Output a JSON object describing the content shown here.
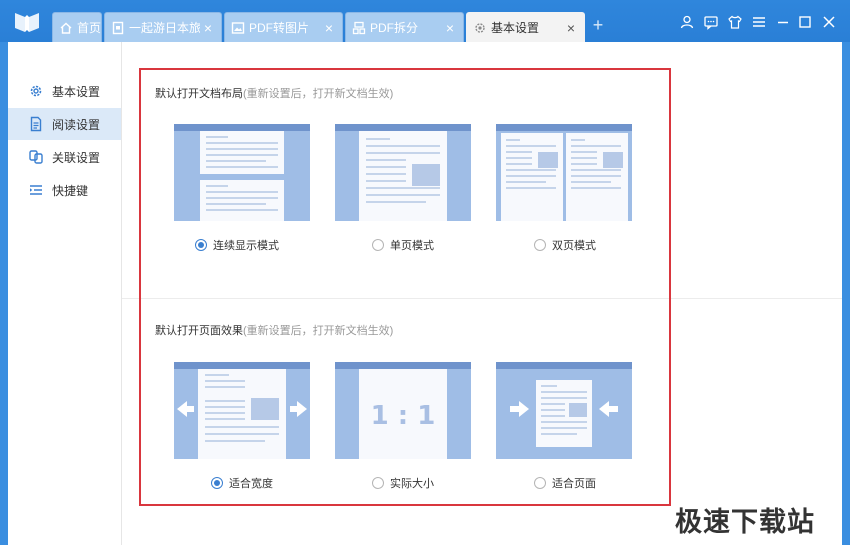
{
  "tabs": [
    {
      "label": "首页",
      "icon": "home-icon",
      "closable": false
    },
    {
      "label": "一起游日本旅游",
      "icon": "document-icon",
      "closable": true
    },
    {
      "label": "PDF转图片",
      "icon": "image-icon",
      "closable": true
    },
    {
      "label": "PDF拆分",
      "icon": "split-icon",
      "closable": true
    },
    {
      "label": "基本设置",
      "icon": "settings-icon",
      "closable": true,
      "active": true
    }
  ],
  "new_tab_symbol": "+",
  "close_symbol": "×",
  "window_controls": [
    "user-icon",
    "feedback-icon",
    "skin-icon",
    "menu-icon",
    "minimize-icon",
    "maximize-icon",
    "close-icon"
  ],
  "sidebar": {
    "items": [
      {
        "label": "基本设置",
        "icon": "gear-icon"
      },
      {
        "label": "阅读设置",
        "icon": "read-doc-icon",
        "active": true
      },
      {
        "label": "关联设置",
        "icon": "link-icon"
      },
      {
        "label": "快捷键",
        "icon": "shortcut-icon"
      }
    ]
  },
  "layout_section": {
    "title": "默认打开文档布局",
    "note": "(重新设置后，打开新文档生效)",
    "options": [
      {
        "label": "连续显示模式",
        "checked": true
      },
      {
        "label": "单页模式",
        "checked": false
      },
      {
        "label": "双页模式",
        "checked": false
      }
    ]
  },
  "effect_section": {
    "title": "默认打开页面效果",
    "note": "(重新设置后，打开新文档生效)",
    "actual_size_text": "1 : 1",
    "options": [
      {
        "label": "适合宽度",
        "checked": true
      },
      {
        "label": "实际大小",
        "checked": false
      },
      {
        "label": "适合页面",
        "checked": false
      }
    ]
  },
  "watermark": "极速下载站",
  "colors": {
    "titlebar": "#2f86dc",
    "accent": "#3a7fd0",
    "highlight_box": "#d9363e",
    "thumb_bg": "#9fbde6",
    "thumb_header": "#6f93cc"
  }
}
